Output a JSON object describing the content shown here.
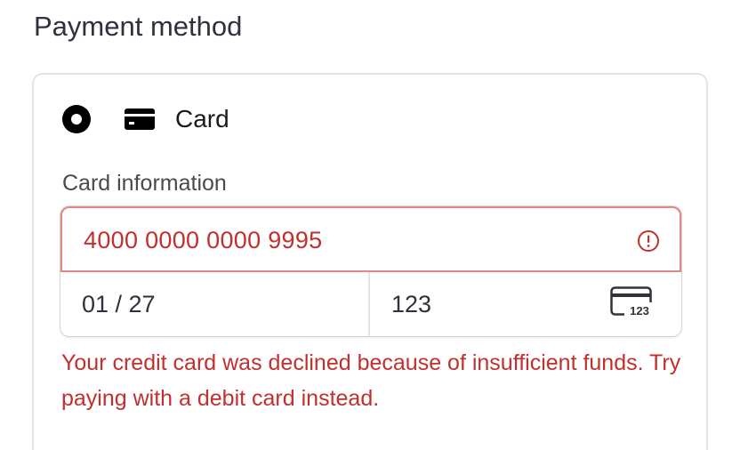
{
  "section": {
    "title": "Payment method"
  },
  "payment_option": {
    "label": "Card",
    "selected": true,
    "icon": "credit-card-icon"
  },
  "card_info": {
    "label": "Card information",
    "card_number": "4000 0000 0000 9995",
    "expiry": "01 / 27",
    "cvc": "123",
    "cvc_icon_text": "123",
    "error_icon": "alert-circle-icon",
    "cvc_icon": "card-cvc-icon"
  },
  "error": {
    "message": "Your credit card was declined because of insufficient funds. Try paying with a debit card instead."
  },
  "colors": {
    "error": "#c2302d",
    "error_border": "#df8a85",
    "border": "#e3e3e3",
    "text": "#30313d"
  }
}
